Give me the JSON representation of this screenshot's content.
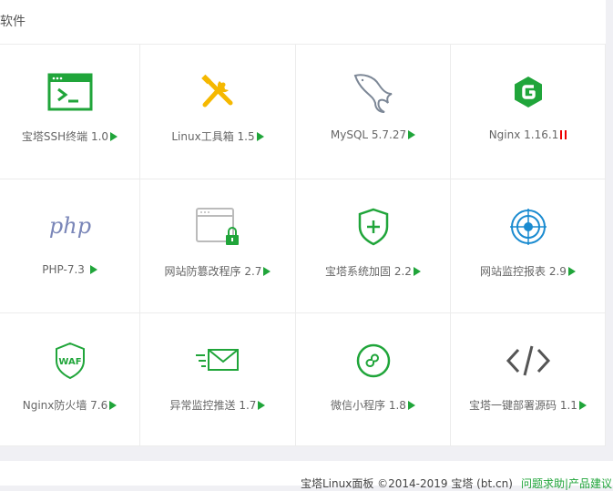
{
  "panel": {
    "title": "软件"
  },
  "apps": [
    {
      "label": "宝塔SSH终端 1.0",
      "icon": "terminal-icon",
      "state": "play"
    },
    {
      "label": "Linux工具箱 1.5",
      "icon": "tools-icon",
      "state": "play"
    },
    {
      "label": "MySQL 5.7.27",
      "icon": "mysql-dolphin-icon",
      "state": "play"
    },
    {
      "label": "Nginx 1.16.1",
      "icon": "nginx-icon",
      "state": "pause"
    },
    {
      "label": "PHP-7.3",
      "icon": "php-icon",
      "state": "play"
    },
    {
      "label": "网站防篡改程序 2.7",
      "icon": "browser-lock-icon",
      "state": "play"
    },
    {
      "label": "宝塔系统加固 2.2",
      "icon": "shield-plus-icon",
      "state": "play"
    },
    {
      "label": "网站监控报表 2.9",
      "icon": "target-icon",
      "state": "play"
    },
    {
      "label": "Nginx防火墙 7.6",
      "icon": "waf-shield-icon",
      "state": "play"
    },
    {
      "label": "异常监控推送 1.7",
      "icon": "mail-send-icon",
      "state": "play"
    },
    {
      "label": "微信小程序 1.8",
      "icon": "mini-program-icon",
      "state": "play"
    },
    {
      "label": "宝塔一键部署源码 1.1",
      "icon": "code-icon",
      "state": "play"
    }
  ],
  "footer": {
    "copyright": "宝塔Linux面板 ©2014-2019 宝塔 (bt.cn)",
    "feedback": "问题求助|产品建议"
  },
  "colors": {
    "accent": "#20a53a",
    "icon_orange": "#f5b800",
    "icon_blue": "#1a8bd0",
    "icon_gray": "#555555",
    "php_purple": "#7a86b8",
    "stop_red": "#e00000"
  }
}
